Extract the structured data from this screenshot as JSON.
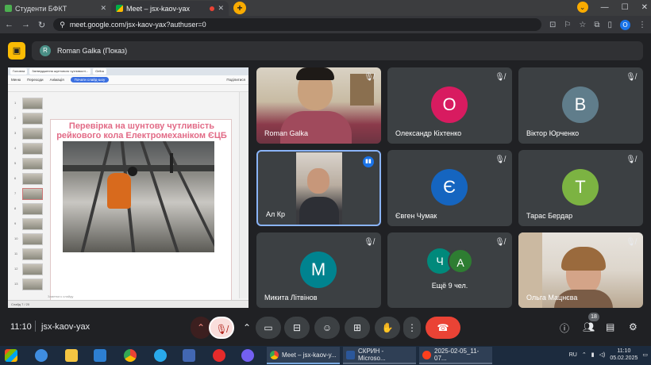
{
  "browser": {
    "tabs": [
      {
        "title": "Студенти БФКТ",
        "active": false
      },
      {
        "title": "Meet – jsx-kaov-yax",
        "active": true
      }
    ],
    "new_tab": "+",
    "url": "meet.google.com/jsx-kaov-yax?authuser=0",
    "profile_initial": "O"
  },
  "presentation": {
    "presenter_initial": "R",
    "label": "Roman Galka (Показ)"
  },
  "shared_screen": {
    "tabs": [
      "Головна",
      "Затвердження шунтового чутливості...",
      "Gelba"
    ],
    "ribbon": [
      "Меню",
      "Переходи",
      "Анімація",
      "Почати слайд-шоу"
    ],
    "present_label": "Поділитися",
    "slide_numbers": [
      "1",
      "2",
      "3",
      "4",
      "5",
      "6",
      "7",
      "8",
      "9",
      "10",
      "11",
      "12",
      "13"
    ],
    "slide_title_line1": "Перевірка на шунтову чутливість",
    "slide_title_line2": "рейкового кола Електромеханіком ЄЦБ",
    "notes_hint": "Заметки к слайду",
    "status": "Слайд 7 / 20"
  },
  "participants": [
    {
      "name": "Roman Galka",
      "type": "video",
      "muted": true
    },
    {
      "name": "Олександр Кіхтенко",
      "type": "avatar",
      "initial": "О",
      "color": "#d81b60",
      "muted": true
    },
    {
      "name": "Віктор Юрченко",
      "type": "avatar",
      "initial": "В",
      "color": "#607d8b",
      "muted": true
    },
    {
      "name": "Ал Кр",
      "type": "video",
      "speaking": true
    },
    {
      "name": "Євген Чумак",
      "type": "avatar",
      "initial": "Є",
      "color": "#1565c0",
      "muted": true
    },
    {
      "name": "Тарас Бердар",
      "type": "avatar",
      "initial": "Т",
      "color": "#7cb342",
      "muted": true
    },
    {
      "name": "Микита Літвінов",
      "type": "avatar",
      "initial": "М",
      "color": "#00838f",
      "muted": true
    },
    {
      "name": "Ещё 9 чел.",
      "type": "group",
      "initials": [
        "Ч",
        "А"
      ],
      "muted": true
    },
    {
      "name": "Ольга Мацнєва",
      "type": "video",
      "muted": true
    }
  ],
  "meeting": {
    "time": "11:10",
    "code": "jsx-kaov-yax",
    "participants_count": "18"
  },
  "taskbar": {
    "apps": [
      "Meet – jsx-kaov-y...",
      "СКРИН - Microso...",
      "2025-02-05_11-07..."
    ],
    "language": "RU",
    "clock_time": "11:10",
    "clock_date": "05.02.2025"
  },
  "colors": {
    "meet_bg": "#202124",
    "tile_bg": "#3c4043",
    "accent_blue": "#1a73e8",
    "end_call_red": "#ea4335",
    "present_yellow": "#fbbc04"
  }
}
